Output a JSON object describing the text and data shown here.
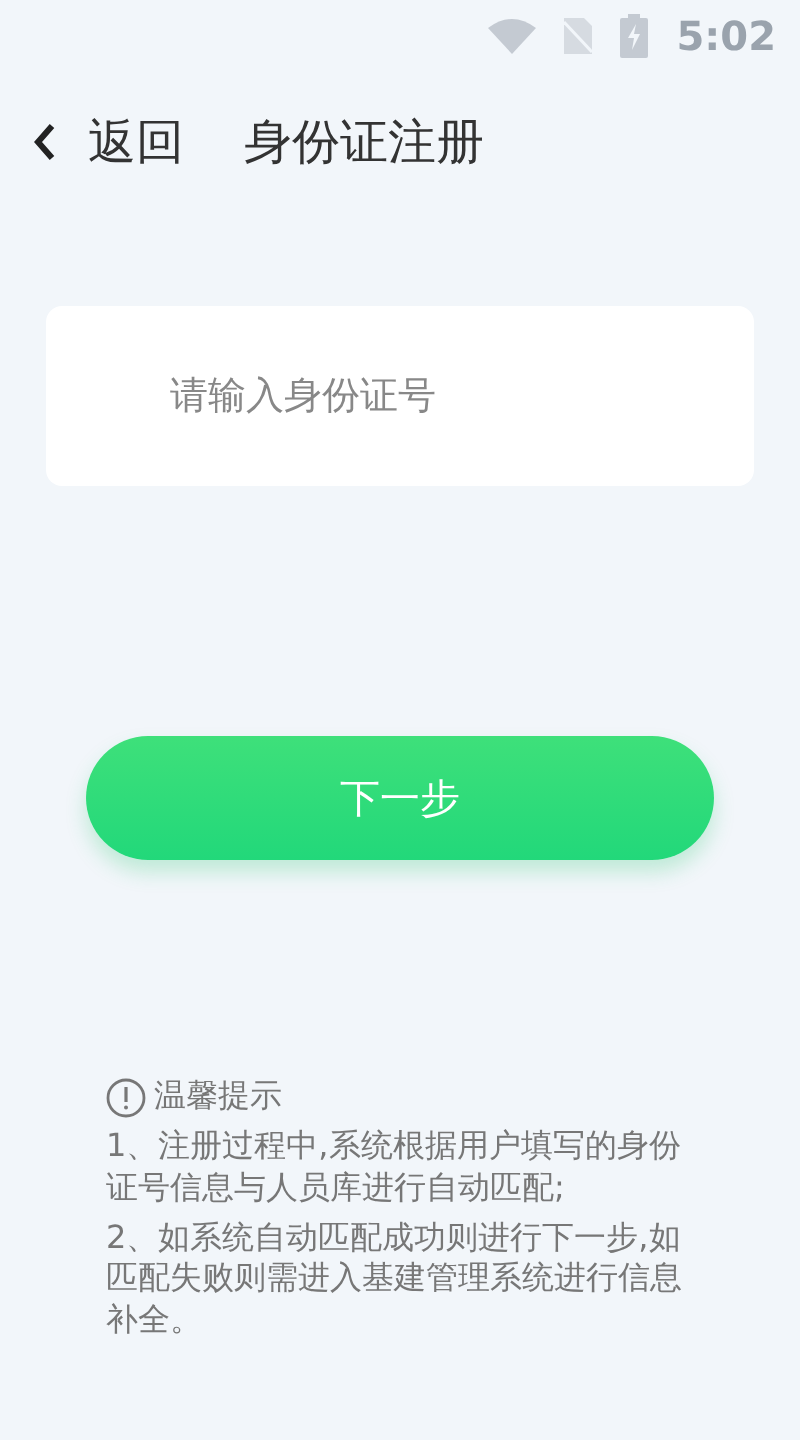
{
  "status_bar": {
    "time": "5:02"
  },
  "header": {
    "back": "返回",
    "title": "身份证注册"
  },
  "id_field": {
    "placeholder": "请输入身份证号"
  },
  "next_button": "下一步",
  "tips": {
    "title": "温馨提示",
    "items": [
      "1、注册过程中,系统根据用户填写的身份证号信息与人员库进行自动匹配;",
      "2、如系统自动匹配成功则进行下一步,如匹配失败则需进入基建管理系统进行信息补全。"
    ]
  }
}
